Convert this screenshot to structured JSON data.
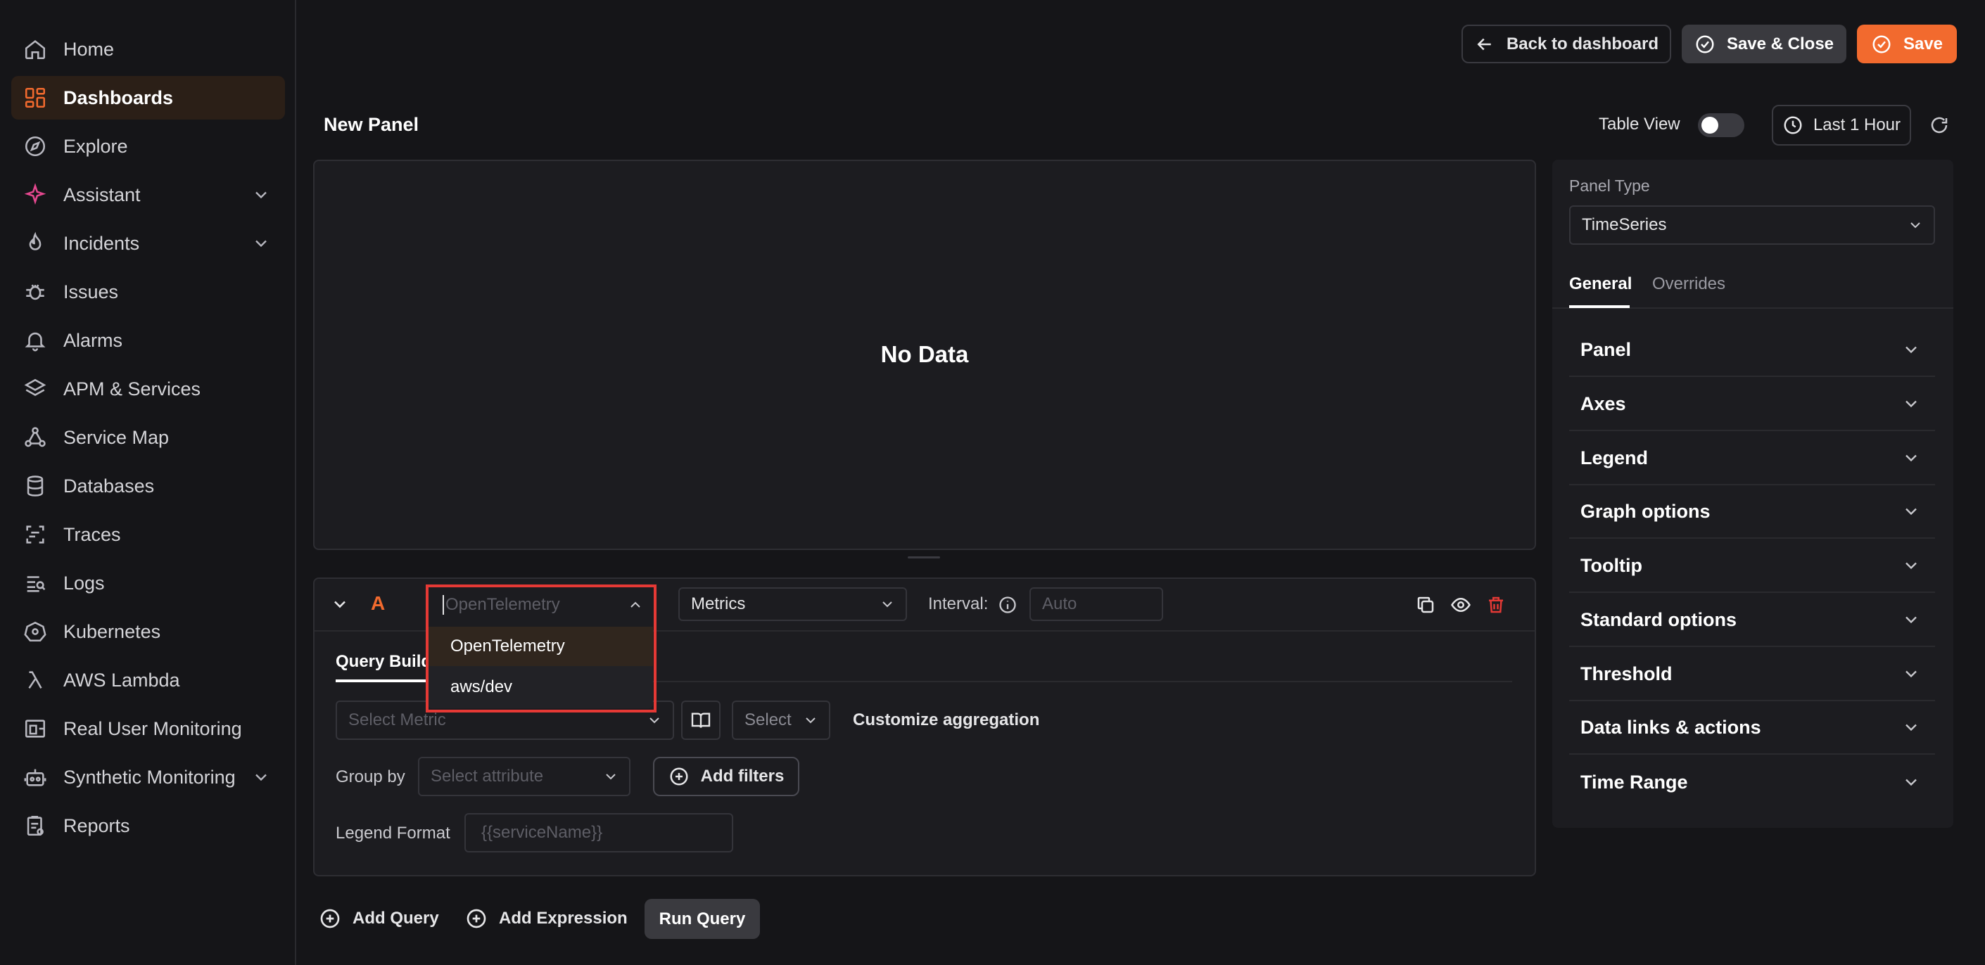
{
  "sidebar": {
    "items": [
      {
        "label": "Home",
        "icon": "home-icon"
      },
      {
        "label": "Dashboards",
        "icon": "dashboard-grid-icon",
        "active": true
      },
      {
        "label": "Explore",
        "icon": "compass-icon"
      },
      {
        "label": "Assistant",
        "icon": "sparkle-icon",
        "expandable": true
      },
      {
        "label": "Incidents",
        "icon": "flame-icon",
        "expandable": true
      },
      {
        "label": "Issues",
        "icon": "bug-icon"
      },
      {
        "label": "Alarms",
        "icon": "bell-icon"
      },
      {
        "label": "APM & Services",
        "icon": "layers-icon"
      },
      {
        "label": "Service Map",
        "icon": "network-icon"
      },
      {
        "label": "Databases",
        "icon": "database-icon"
      },
      {
        "label": "Traces",
        "icon": "traces-icon"
      },
      {
        "label": "Logs",
        "icon": "logs-icon"
      },
      {
        "label": "Kubernetes",
        "icon": "kubernetes-icon"
      },
      {
        "label": "AWS Lambda",
        "icon": "lambda-icon"
      },
      {
        "label": "Real User Monitoring",
        "icon": "rum-icon"
      },
      {
        "label": "Synthetic Monitoring",
        "icon": "robot-icon",
        "expandable": true
      },
      {
        "label": "Reports",
        "icon": "report-icon"
      }
    ]
  },
  "topbar": {
    "back_label": "Back to dashboard",
    "save_close_label": "Save & Close",
    "save_label": "Save"
  },
  "panel": {
    "title": "New Panel",
    "table_view_label": "Table View",
    "table_view_on": false,
    "time_range_label": "Last 1 Hour",
    "no_data": "No Data"
  },
  "query": {
    "letter": "A",
    "datasource_placeholder": "OpenTelemetry",
    "datasource_options": [
      "OpenTelemetry",
      "aws/dev"
    ],
    "type_value": "Metrics",
    "interval_label": "Interval:",
    "interval_placeholder": "Auto",
    "tab_label": "Query Builder",
    "metric_placeholder": "Select Metric",
    "agg_placeholder": "Select",
    "customize_label": "Customize aggregation",
    "group_by_label": "Group by",
    "group_by_placeholder": "Select attribute",
    "add_filters_label": "Add filters",
    "legend_format_label": "Legend Format",
    "legend_format_placeholder": "{{serviceName}}"
  },
  "actions": {
    "add_query": "Add Query",
    "add_expression": "Add Expression",
    "run_query": "Run Query"
  },
  "settings": {
    "panel_type_label": "Panel Type",
    "panel_type_value": "TimeSeries",
    "tabs": [
      "General",
      "Overrides"
    ],
    "sections": [
      "Panel",
      "Axes",
      "Legend",
      "Graph options",
      "Tooltip",
      "Standard options",
      "Threshold",
      "Data links & actions",
      "Time Range"
    ]
  },
  "colors": {
    "accent": "#f26a2e",
    "danger": "#e53935",
    "background": "#151518"
  }
}
